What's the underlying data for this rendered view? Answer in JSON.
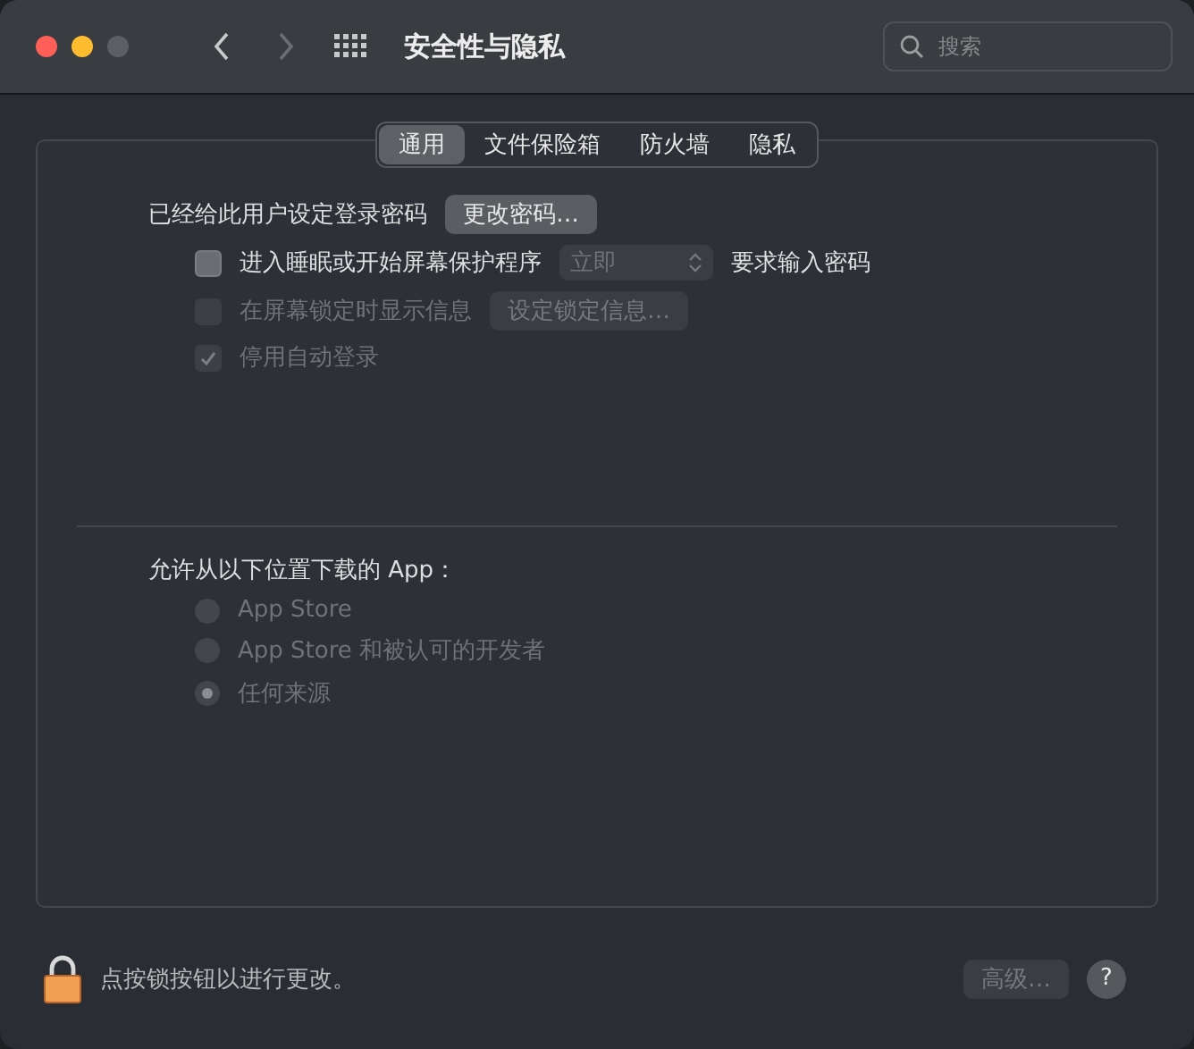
{
  "window": {
    "title": "安全性与隐私",
    "search": {
      "placeholder": "搜索"
    }
  },
  "tabs": [
    {
      "label": "通用",
      "selected": true
    },
    {
      "label": "文件保险箱",
      "selected": false
    },
    {
      "label": "防火墙",
      "selected": false
    },
    {
      "label": "隐私",
      "selected": false
    }
  ],
  "password": {
    "label": "已经给此用户设定登录密码",
    "button": "更改密码…"
  },
  "options": [
    {
      "kind": "popup",
      "label": "进入睡眠或开始屏幕保护程序",
      "checked": false,
      "disabled": false,
      "popup": {
        "value": "立即",
        "disabled": true
      },
      "suffix": "要求输入密码"
    },
    {
      "kind": "button",
      "label": "在屏幕锁定时显示信息",
      "checked": false,
      "disabled": true,
      "button": {
        "label": "设定锁定信息…",
        "disabled": true
      }
    },
    {
      "kind": "plain",
      "label": "停用自动登录",
      "checked": true,
      "disabled": true
    }
  ],
  "downloads": {
    "label": "允许从以下位置下载的 App：",
    "choices": [
      {
        "label": "App Store",
        "selected": false,
        "disabled": true
      },
      {
        "label": "App Store 和被认可的开发者",
        "selected": false,
        "disabled": true
      },
      {
        "label": "任何来源",
        "selected": true,
        "disabled": true
      }
    ]
  },
  "footer": {
    "lock_text": "点按锁按钮以进行更改。",
    "advanced_button": {
      "label": "高级…",
      "disabled": true
    },
    "help_button": "?"
  }
}
